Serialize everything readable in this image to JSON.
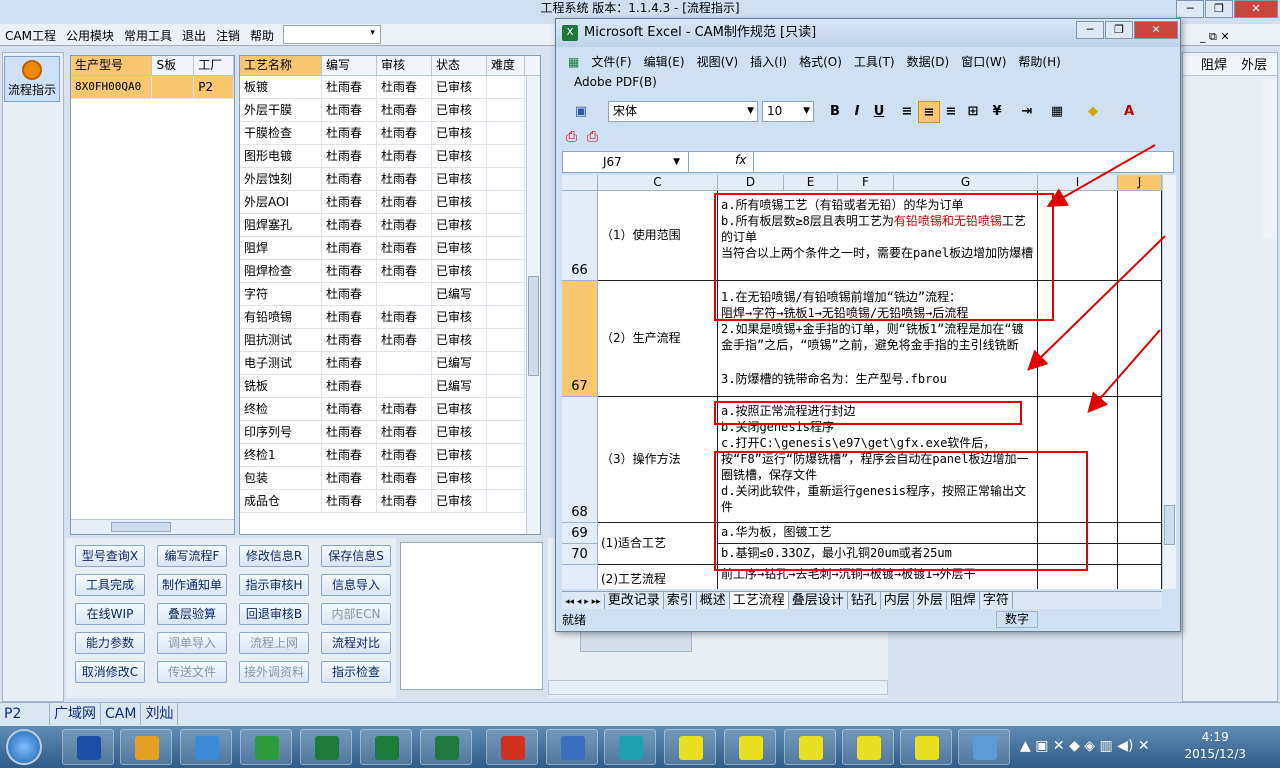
{
  "app": {
    "title": "工程系统  版本：1.1.4.3 - [流程指示]",
    "menu": [
      "CAM工程",
      "公用模块",
      "常用工具",
      "退出",
      "注销",
      "帮助"
    ],
    "flow_button": "流程指示"
  },
  "order_grid": {
    "headers": [
      "生产型号",
      "S板",
      "工厂"
    ],
    "rows": [
      [
        "8X0FH00QA0",
        "",
        "P2"
      ]
    ]
  },
  "process_grid": {
    "headers": [
      "工艺名称",
      "编写",
      "审核",
      "状态",
      "难度"
    ],
    "rows": [
      [
        "板镀",
        "杜雨春",
        "杜雨春",
        "已审核"
      ],
      [
        "外层干膜",
        "杜雨春",
        "杜雨春",
        "已审核"
      ],
      [
        "干膜检查",
        "杜雨春",
        "杜雨春",
        "已审核"
      ],
      [
        "图形电镀",
        "杜雨春",
        "杜雨春",
        "已审核"
      ],
      [
        "外层蚀刻",
        "杜雨春",
        "杜雨春",
        "已审核"
      ],
      [
        "外层AOI",
        "杜雨春",
        "杜雨春",
        "已审核"
      ],
      [
        "阻焊塞孔",
        "杜雨春",
        "杜雨春",
        "已审核"
      ],
      [
        "阻焊",
        "杜雨春",
        "杜雨春",
        "已审核"
      ],
      [
        "阻焊检查",
        "杜雨春",
        "杜雨春",
        "已审核"
      ],
      [
        "字符",
        "杜雨春",
        "",
        "已编写"
      ],
      [
        "有铅喷锡",
        "杜雨春",
        "杜雨春",
        "已审核"
      ],
      [
        "阻抗测试",
        "杜雨春",
        "杜雨春",
        "已审核"
      ],
      [
        "电子测试",
        "杜雨春",
        "",
        "已编写"
      ],
      [
        "铣板",
        "杜雨春",
        "",
        "已编写"
      ],
      [
        "终检",
        "杜雨春",
        "杜雨春",
        "已审核"
      ],
      [
        "印序列号",
        "杜雨春",
        "杜雨春",
        "已审核"
      ],
      [
        "终检1",
        "杜雨春",
        "杜雨春",
        "已审核"
      ],
      [
        "包装",
        "杜雨春",
        "杜雨春",
        "已审核"
      ],
      [
        "成品仓",
        "杜雨春",
        "杜雨春",
        "已审核"
      ]
    ]
  },
  "action_buttons": [
    {
      "label": "型号查询X",
      "enabled": true
    },
    {
      "label": "编写流程F",
      "enabled": true
    },
    {
      "label": "修改信息R",
      "enabled": true
    },
    {
      "label": "保存信息S",
      "enabled": true
    },
    {
      "label": "工具完成",
      "enabled": true
    },
    {
      "label": "制作通知单",
      "enabled": true
    },
    {
      "label": "指示审核H",
      "enabled": true
    },
    {
      "label": "信息导入",
      "enabled": true
    },
    {
      "label": "在线WIP",
      "enabled": true
    },
    {
      "label": "叠层验算",
      "enabled": true
    },
    {
      "label": "回退审核B",
      "enabled": true
    },
    {
      "label": "内部ECN",
      "enabled": false
    },
    {
      "label": "能力参数",
      "enabled": true
    },
    {
      "label": "调单导入",
      "enabled": false
    },
    {
      "label": "流程上网",
      "enabled": false
    },
    {
      "label": "流程对比",
      "enabled": true
    },
    {
      "label": "取消修改C",
      "enabled": true
    },
    {
      "label": "传送文件",
      "enabled": false
    },
    {
      "label": "接外调资料",
      "enabled": false
    },
    {
      "label": "指示检查",
      "enabled": true
    }
  ],
  "right_panel_headers": [
    "阻焊",
    "外层"
  ],
  "statusbar": [
    "P2",
    "广域网",
    "CAM",
    "刘灿"
  ],
  "clock": {
    "time": "4:19",
    "date": "2015/12/3"
  },
  "excel": {
    "title": "Microsoft Excel - CAM制作规范  [只读]",
    "menu": [
      "文件(F)",
      "编辑(E)",
      "视图(V)",
      "插入(I)",
      "格式(O)",
      "工具(T)",
      "数据(D)",
      "窗口(W)",
      "帮助(H)"
    ],
    "menu2": "Adobe PDF(B)",
    "font": "宋体",
    "font_size": "10",
    "namebox": "J67",
    "fx": "fx",
    "columns": [
      "C",
      "D",
      "E",
      "F",
      "G",
      "I",
      "J"
    ],
    "rows": [
      {
        "num": "66",
        "label": "（1）使用范围",
        "text": "a.所有喷锡工艺（有铅或者无铅）的华为订单\nb.所有板层数≥8层且表明工艺为",
        "red": "有铅喷锡和无铅喷锡",
        "text2": "工艺的订单\n当符合以上两个条件之一时，需要在panel板边增加防爆槽"
      },
      {
        "num": "67",
        "label": "（2）生产流程",
        "text": "1.在无铅喷锡/有铅喷锡前增加“铣边”流程：\n阻焊→字符→铣板1→无铅喷锡/无铅喷锡→后流程\n2.如果是喷锡+金手指的订单，则“铣板1”流程是加在“镀金手指”之后，“喷锡”之前，避免将金手指的主引线铣断",
        "text3": "3.防爆槽的铣带命名为：生产型号.fbrou"
      },
      {
        "num": "68",
        "label": "（3）操作方法",
        "text": "a.按照正常流程进行封边\nb.关闭genesis程序\nc.打开C:\\genesis\\e97\\get\\gfx.exe软件后，按“F8”运行“防爆铣槽”，程序会自动在panel板边增加一圈铣槽，保存文件\nd.关闭此软件，重新运行genesis程序，按照正常输出文件"
      },
      {
        "num": "69",
        "label": "(1)适合工艺",
        "text": "a.华为板，图镀工艺"
      },
      {
        "num": "70",
        "label": "",
        "text": "b.基铜≤0.33OZ，最小孔铜20um或者25um"
      },
      {
        "num": "",
        "label": "(2)工艺流程",
        "text": "前工序→钻孔→去毛刺→沉铜→板镀→板镀1→外层干"
      }
    ],
    "sheet_tabs": [
      "更改记录",
      "索引",
      "概述",
      "工艺流程",
      "叠层设计",
      "钻孔",
      "内层",
      "外层",
      "阻焊",
      "字符"
    ],
    "active_tab": "工艺流程",
    "status_left": "就绪",
    "status_right": "数字"
  }
}
